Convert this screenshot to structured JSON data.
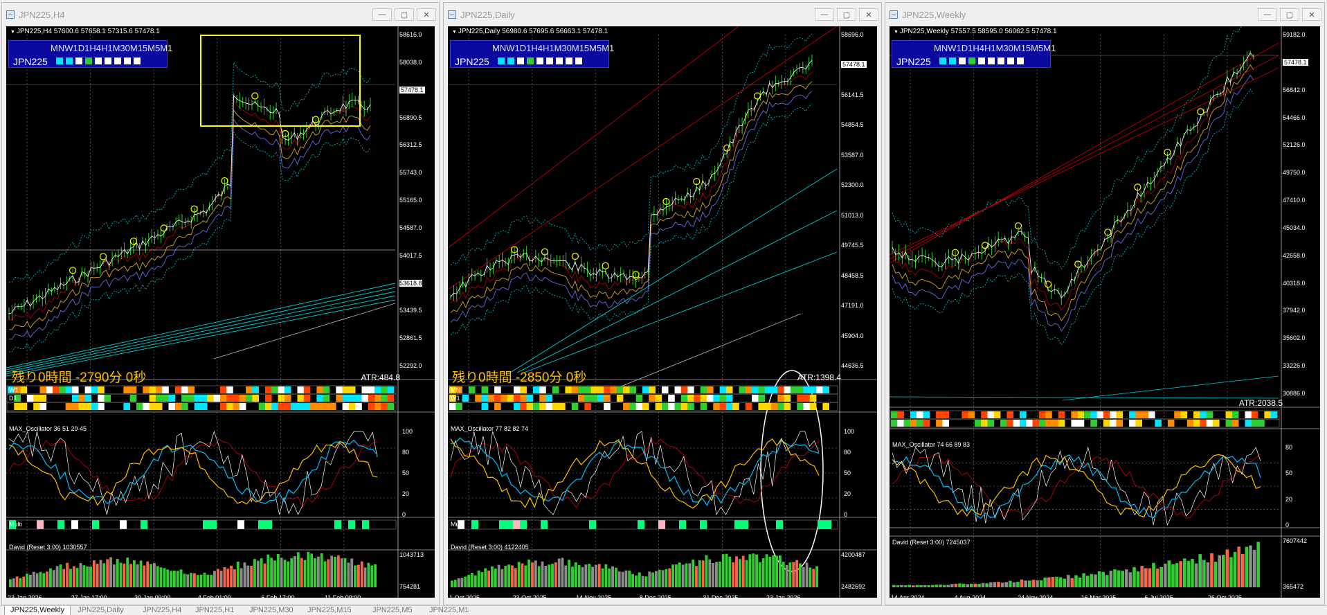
{
  "windows": [
    {
      "title": "JPN225,H4",
      "header": "JPN225,H4  57600.6 57658.1 57315.6 57478.1",
      "timeframes": "MNW1D1H4H1M30M15M5M1",
      "symbol": "JPN225",
      "remain": "残り0時間 -2790分 0秒",
      "atr": "ATR:484.8",
      "price_labels": [
        "58616.0",
        "58038.0",
        "57478.1",
        "56890.5",
        "56312.5",
        "55743.0",
        "55165.0",
        "54587.0",
        "54017.5",
        "53618.8",
        "53439.5",
        "52861.5",
        "52292.0"
      ],
      "current_price": "57478.1",
      "line_price": "53618.8",
      "osc_label": "MAX_Oscillator 36 51 29 45",
      "osc_levels": [
        "100",
        "80",
        "50",
        "20",
        "0"
      ],
      "david_label": "David (Reset 3:00) 1030557",
      "david_levels": [
        "1043713",
        "754281"
      ],
      "row_labels": [
        "W1",
        "D1"
      ],
      "mini_label": "Multi",
      "dates": [
        "23 Jan 2026",
        "27 Jan 17:00",
        "30 Jan 09:00",
        "4 Feb 01:00",
        "6 Feb 17:00",
        "11 Feb 09:00"
      ]
    },
    {
      "title": "JPN225,Daily",
      "header": "JPN225,Daily  56980.6 57695.6 56663.1 57478.1",
      "timeframes": "MNW1D1H4H1M30M15M5M1",
      "symbol": "JPN225",
      "remain": "残り0時間 -2850分 0秒",
      "atr": "ATR:1398.4",
      "price_labels": [
        "58696.0",
        "57478.1",
        "56141.5",
        "54854.5",
        "53587.0",
        "52300.0",
        "51013.0",
        "49745.5",
        "48458.5",
        "47191.0",
        "45904.0",
        "44636.5"
      ],
      "current_price": "57478.1",
      "osc_label": "MAX_Oscillator 77 82 82 74",
      "osc_levels": [
        "100",
        "80",
        "50",
        "20",
        "0"
      ],
      "david_label": "David (Reset 3:00) 4122405",
      "david_levels": [
        "4200487",
        "2482692"
      ],
      "row_labels": [
        "MN",
        "W1"
      ],
      "mini_label": "Multi",
      "dates": [
        "1 Oct 2025",
        "23 Oct 2025",
        "14 Nov 2025",
        "8 Dec 2025",
        "31 Dec 2025",
        "23 Jan 2026"
      ]
    },
    {
      "title": "JPN225,Weekly",
      "header": "JPN225,Weekly  57557.5 58595.0 56062.5 57478.1",
      "timeframes": "MNW1D1H4H1M30M15M5M1",
      "symbol": "JPN225",
      "atr": "ATR:2038.5",
      "price_labels": [
        "59182.0",
        "57478.1",
        "56842.0",
        "54466.0",
        "52126.0",
        "49750.0",
        "47410.0",
        "45034.0",
        "42658.0",
        "40318.0",
        "37942.0",
        "35602.0",
        "33226.0",
        "30886.0"
      ],
      "current_price": "57478.1",
      "osc_label": "MAX_Oscillator 74 66 89 83",
      "osc_levels": [
        "80",
        "50",
        "20",
        "0"
      ],
      "david_label": "David (Reset 3:00) 7245037",
      "david_levels": [
        "7607442",
        "365472"
      ],
      "dates": [
        "14 Apr 2024",
        "4 Aug 2024",
        "24 Nov 2024",
        "16 Mar 2025",
        "6 Jul 2025",
        "26 Oct 2025"
      ]
    }
  ],
  "tabs": [
    "JPN225,Weekly",
    "JPN225,Daily",
    "JPN225,H4",
    "JPN225,H1",
    "JPN225,M30",
    "JPN225,M15",
    "JPN225,M5",
    "JPN225,M1"
  ],
  "colors": {
    "candle_up": "#32cd32",
    "circle": "#ffff00",
    "highlight": "#ffff00",
    "trend_cyan": "#00ced1",
    "trend_red": "#c00000",
    "osc_yellow": "#ffc000",
    "osc_cyan": "#00bfff",
    "osc_red": "#c00000"
  }
}
